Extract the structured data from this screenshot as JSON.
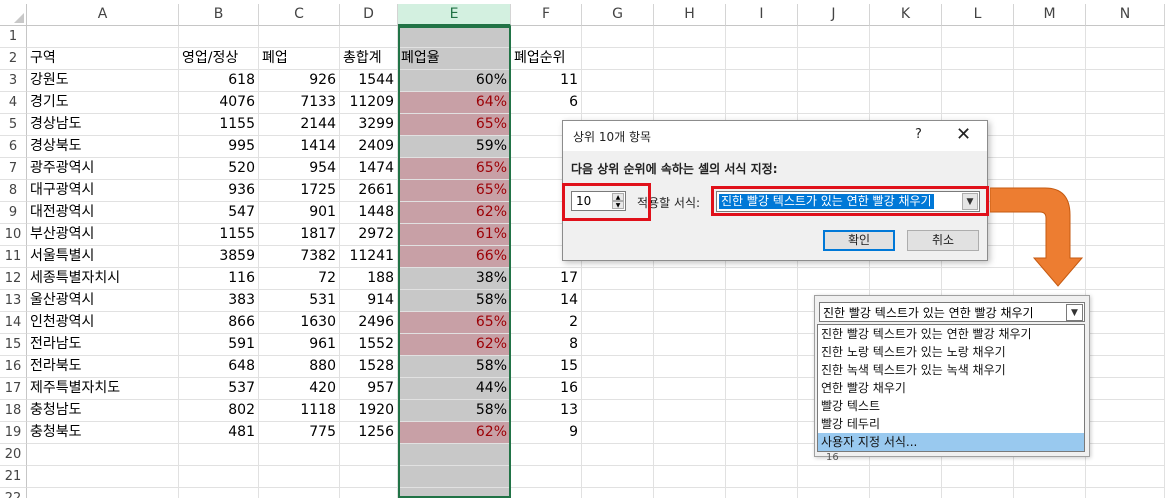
{
  "columns": [
    "A",
    "B",
    "C",
    "D",
    "E",
    "F",
    "G",
    "H",
    "I",
    "J",
    "K",
    "L",
    "M",
    "N"
  ],
  "row_numbers": [
    "1",
    "2",
    "3",
    "4",
    "5",
    "6",
    "7",
    "8",
    "9",
    "10",
    "11",
    "12",
    "13",
    "14",
    "15",
    "16",
    "17",
    "18",
    "19",
    "20",
    "21",
    "22"
  ],
  "headers": {
    "a": "구역",
    "b": "영업/정상",
    "c": "폐업",
    "d": "총합계",
    "e": "폐업율",
    "f": "폐업순위"
  },
  "rows": [
    {
      "a": "강원도",
      "b": "618",
      "c": "926",
      "d": "1544",
      "e": "60%",
      "f": "11",
      "top10": false
    },
    {
      "a": "경기도",
      "b": "4076",
      "c": "7133",
      "d": "11209",
      "e": "64%",
      "f": "6",
      "top10": true
    },
    {
      "a": "경상남도",
      "b": "1155",
      "c": "2144",
      "d": "3299",
      "e": "65%",
      "f": "",
      "top10": true
    },
    {
      "a": "경상북도",
      "b": "995",
      "c": "1414",
      "d": "2409",
      "e": "59%",
      "f": "",
      "top10": false
    },
    {
      "a": "광주광역시",
      "b": "520",
      "c": "954",
      "d": "1474",
      "e": "65%",
      "f": "",
      "top10": true
    },
    {
      "a": "대구광역시",
      "b": "936",
      "c": "1725",
      "d": "2661",
      "e": "65%",
      "f": "",
      "top10": true
    },
    {
      "a": "대전광역시",
      "b": "547",
      "c": "901",
      "d": "1448",
      "e": "62%",
      "f": "",
      "top10": true
    },
    {
      "a": "부산광역시",
      "b": "1155",
      "c": "1817",
      "d": "2972",
      "e": "61%",
      "f": "",
      "top10": true
    },
    {
      "a": "서울특별시",
      "b": "3859",
      "c": "7382",
      "d": "11241",
      "e": "66%",
      "f": "",
      "top10": true
    },
    {
      "a": "세종특별자치시",
      "b": "116",
      "c": "72",
      "d": "188",
      "e": "38%",
      "f": "17",
      "top10": false
    },
    {
      "a": "울산광역시",
      "b": "383",
      "c": "531",
      "d": "914",
      "e": "58%",
      "f": "14",
      "top10": false
    },
    {
      "a": "인천광역시",
      "b": "866",
      "c": "1630",
      "d": "2496",
      "e": "65%",
      "f": "2",
      "top10": true
    },
    {
      "a": "전라남도",
      "b": "591",
      "c": "961",
      "d": "1552",
      "e": "62%",
      "f": "8",
      "top10": true
    },
    {
      "a": "전라북도",
      "b": "648",
      "c": "880",
      "d": "1528",
      "e": "58%",
      "f": "15",
      "top10": false
    },
    {
      "a": "제주특별자치도",
      "b": "537",
      "c": "420",
      "d": "957",
      "e": "44%",
      "f": "16",
      "top10": false
    },
    {
      "a": "충청남도",
      "b": "802",
      "c": "1118",
      "d": "1920",
      "e": "58%",
      "f": "13",
      "top10": false
    },
    {
      "a": "충청북도",
      "b": "481",
      "c": "775",
      "d": "1256",
      "e": "62%",
      "f": "9",
      "top10": true
    }
  ],
  "dialog": {
    "title": "상위 10개 항목",
    "help": "?",
    "close": "✕",
    "prompt": "다음 상위 순위에 속하는 셀의 서식 지정:",
    "count_value": "10",
    "format_label": "적용할 서식:",
    "format_value": "진한 빨강 텍스트가 있는 연한 빨강 채우기",
    "ok": "확인",
    "cancel": "취소"
  },
  "dropdown": {
    "current": "진한 빨강 텍스트가 있는 연한 빨강 채우기",
    "options": [
      "진한 빨강 텍스트가 있는 연한 빨강 채우기",
      "진한 노랑 텍스트가 있는 노랑 채우기",
      "진한 녹색 텍스트가 있는 녹색 채우기",
      "연한 빨강 채우기",
      "빨강 텍스트",
      "빨강 테두리",
      "사용자 지정 서식..."
    ],
    "highlighted_index": 6,
    "partial_text_below": "16"
  },
  "colors": {
    "highlight_fill": "#c8a0a6",
    "highlight_text": "#9c0006",
    "plain_fill": "#c8c8c8",
    "annotation_red": "#e0101a",
    "arrow_orange": "#ed7d31",
    "selected_column": "#217346"
  },
  "icons": {
    "spin": "spinner-up-down-icon",
    "dropdown": "chevron-down-icon",
    "arrow": "orange-curved-arrow-icon"
  }
}
